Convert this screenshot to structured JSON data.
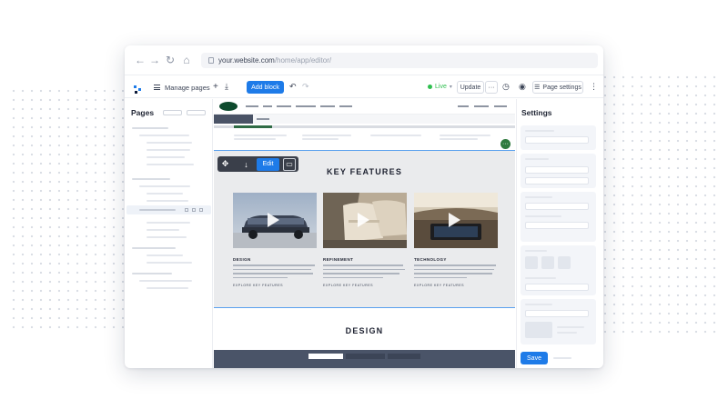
{
  "browser": {
    "url_domain": "your.website.com",
    "url_path": "/home/app/editor/"
  },
  "toolbar": {
    "manage_pages": "Manage pages",
    "add_block": "Add block",
    "live": "Live",
    "update": "Update",
    "more": "···",
    "page_settings": "Page settings",
    "kebab": "⋮"
  },
  "pages_panel": {
    "title": "Pages"
  },
  "canvas": {
    "key_features_title": "KEY FEATURES",
    "design_title": "DESIGN",
    "block_tools": {
      "edit": "Edit"
    },
    "cards": [
      {
        "title": "DESIGN",
        "link": "EXPLORE KEY FEATURES"
      },
      {
        "title": "REFINEMENT",
        "link": "EXPLORE KEY FEATURES"
      },
      {
        "title": "TECHNOLOGY",
        "link": "EXPLORE KEY FEATURES"
      }
    ]
  },
  "settings_panel": {
    "title": "Settings",
    "save": "Save"
  },
  "colors": {
    "accent": "#1e7be8",
    "live_green": "#2fbf4f",
    "brand_green": "#0d4a2d",
    "selection": "#5aa0ee"
  },
  "icons": {
    "back": "back-arrow-icon",
    "forward": "forward-arrow-icon",
    "reload": "reload-icon",
    "home": "home-icon",
    "lock": "lock-icon",
    "menu": "menu-icon",
    "plus": "plus-icon",
    "import": "import-icon",
    "undo": "undo-icon",
    "redo": "redo-icon",
    "history": "history-icon",
    "preview": "eye-icon",
    "move": "move-icon",
    "arrow_down": "arrow-down-icon",
    "trash": "trash-icon",
    "play": "play-icon"
  }
}
